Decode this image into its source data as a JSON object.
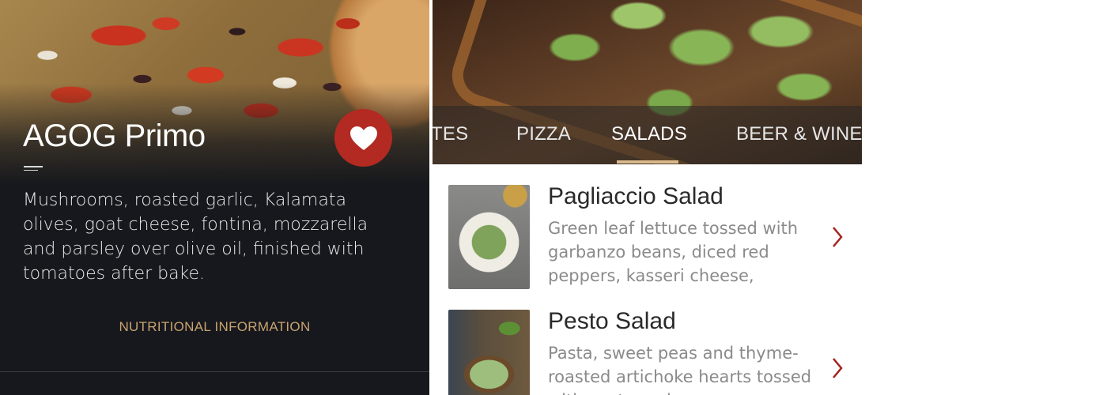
{
  "detail": {
    "title": "AGOG Primo",
    "description": "Mushrooms, roasted garlic, Kalamata olives, goat cheese, fontina, mozzarella and parsley over olive oil, finished with tomatoes after bake.",
    "nutrition_link": "NUTRITIONAL INFORMATION",
    "favorite_icon": "heart-icon",
    "menu_icon": "menu-lines-icon"
  },
  "menu": {
    "tabs": [
      {
        "label": "TES",
        "active": false
      },
      {
        "label": "PIZZA",
        "active": false
      },
      {
        "label": "SALADS",
        "active": true
      },
      {
        "label": "BEER & WINE",
        "active": false
      }
    ],
    "items": [
      {
        "title": "Pagliaccio Salad",
        "description": "Green leaf lettuce tossed with garbanzo beans, diced red peppers, kasseri cheese, salami,…"
      },
      {
        "title": "Pesto Salad",
        "description": "Pasta, sweet peas and thyme-roasted artichoke hearts tossed with pesto and parmesan"
      }
    ]
  },
  "colors": {
    "accent_red": "#b22a22",
    "accent_gold": "#c9a36f",
    "panel_dark": "#16181d",
    "chevron_red": "#a3231d"
  }
}
